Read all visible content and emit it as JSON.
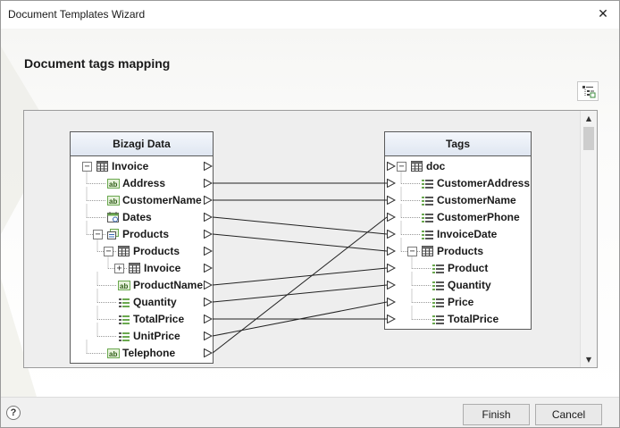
{
  "window": {
    "title": "Document Templates Wizard",
    "close_symbol": "✕"
  },
  "page": {
    "heading": "Document tags mapping"
  },
  "left_table": {
    "header": "Bizagi Data",
    "rows": [
      {
        "label": "Invoice",
        "icon": "table-icon",
        "expander": "−"
      },
      {
        "label": "Address",
        "icon": "text-field-icon"
      },
      {
        "label": "CustomerName",
        "icon": "text-field-icon"
      },
      {
        "label": "Dates",
        "icon": "calendar-icon"
      },
      {
        "label": "Products",
        "icon": "collection-icon",
        "expander": "−"
      },
      {
        "label": "Products",
        "icon": "table-icon",
        "expander": "−"
      },
      {
        "label": "Invoice",
        "icon": "table-icon",
        "expander": "+"
      },
      {
        "label": "ProductName",
        "icon": "text-field-icon"
      },
      {
        "label": "Quantity",
        "icon": "numeric-field-icon"
      },
      {
        "label": "TotalPrice",
        "icon": "numeric-field-icon"
      },
      {
        "label": "UnitPrice",
        "icon": "numeric-field-icon"
      },
      {
        "label": "Telephone",
        "icon": "text-field-icon"
      }
    ]
  },
  "right_table": {
    "header": "Tags",
    "rows": [
      {
        "label": "doc",
        "icon": "table-icon",
        "expander": "−"
      },
      {
        "label": "CustomerAddress",
        "icon": "tag-field-icon"
      },
      {
        "label": "CustomerName",
        "icon": "tag-field-icon"
      },
      {
        "label": "CustomerPhone",
        "icon": "tag-field-icon"
      },
      {
        "label": "InvoiceDate",
        "icon": "tag-field-icon"
      },
      {
        "label": "Products",
        "icon": "table-icon",
        "expander": "−"
      },
      {
        "label": "Product",
        "icon": "tag-field-icon"
      },
      {
        "label": "Quantity",
        "icon": "tag-field-icon"
      },
      {
        "label": "Price",
        "icon": "tag-field-icon"
      },
      {
        "label": "TotalPrice",
        "icon": "tag-field-icon"
      }
    ]
  },
  "mappings": [
    {
      "from": "Address",
      "to": "CustomerAddress"
    },
    {
      "from": "CustomerName",
      "to": "CustomerName"
    },
    {
      "from": "Dates",
      "to": "InvoiceDate"
    },
    {
      "from": "Products",
      "to": "Products"
    },
    {
      "from": "ProductName",
      "to": "Product"
    },
    {
      "from": "Quantity",
      "to": "Quantity"
    },
    {
      "from": "TotalPrice",
      "to": "TotalPrice"
    },
    {
      "from": "UnitPrice",
      "to": "Price"
    },
    {
      "from": "Telephone",
      "to": "CustomerPhone"
    }
  ],
  "footer": {
    "help": "?",
    "finish": "Finish",
    "cancel": "Cancel"
  },
  "scrollbar": {
    "up": "▲",
    "down": "▼"
  },
  "colors": {
    "icon_green": "#6aa84f",
    "icon_blue": "#3b6cb5",
    "line": "#222222",
    "header_bg": "#dfe6f1"
  }
}
